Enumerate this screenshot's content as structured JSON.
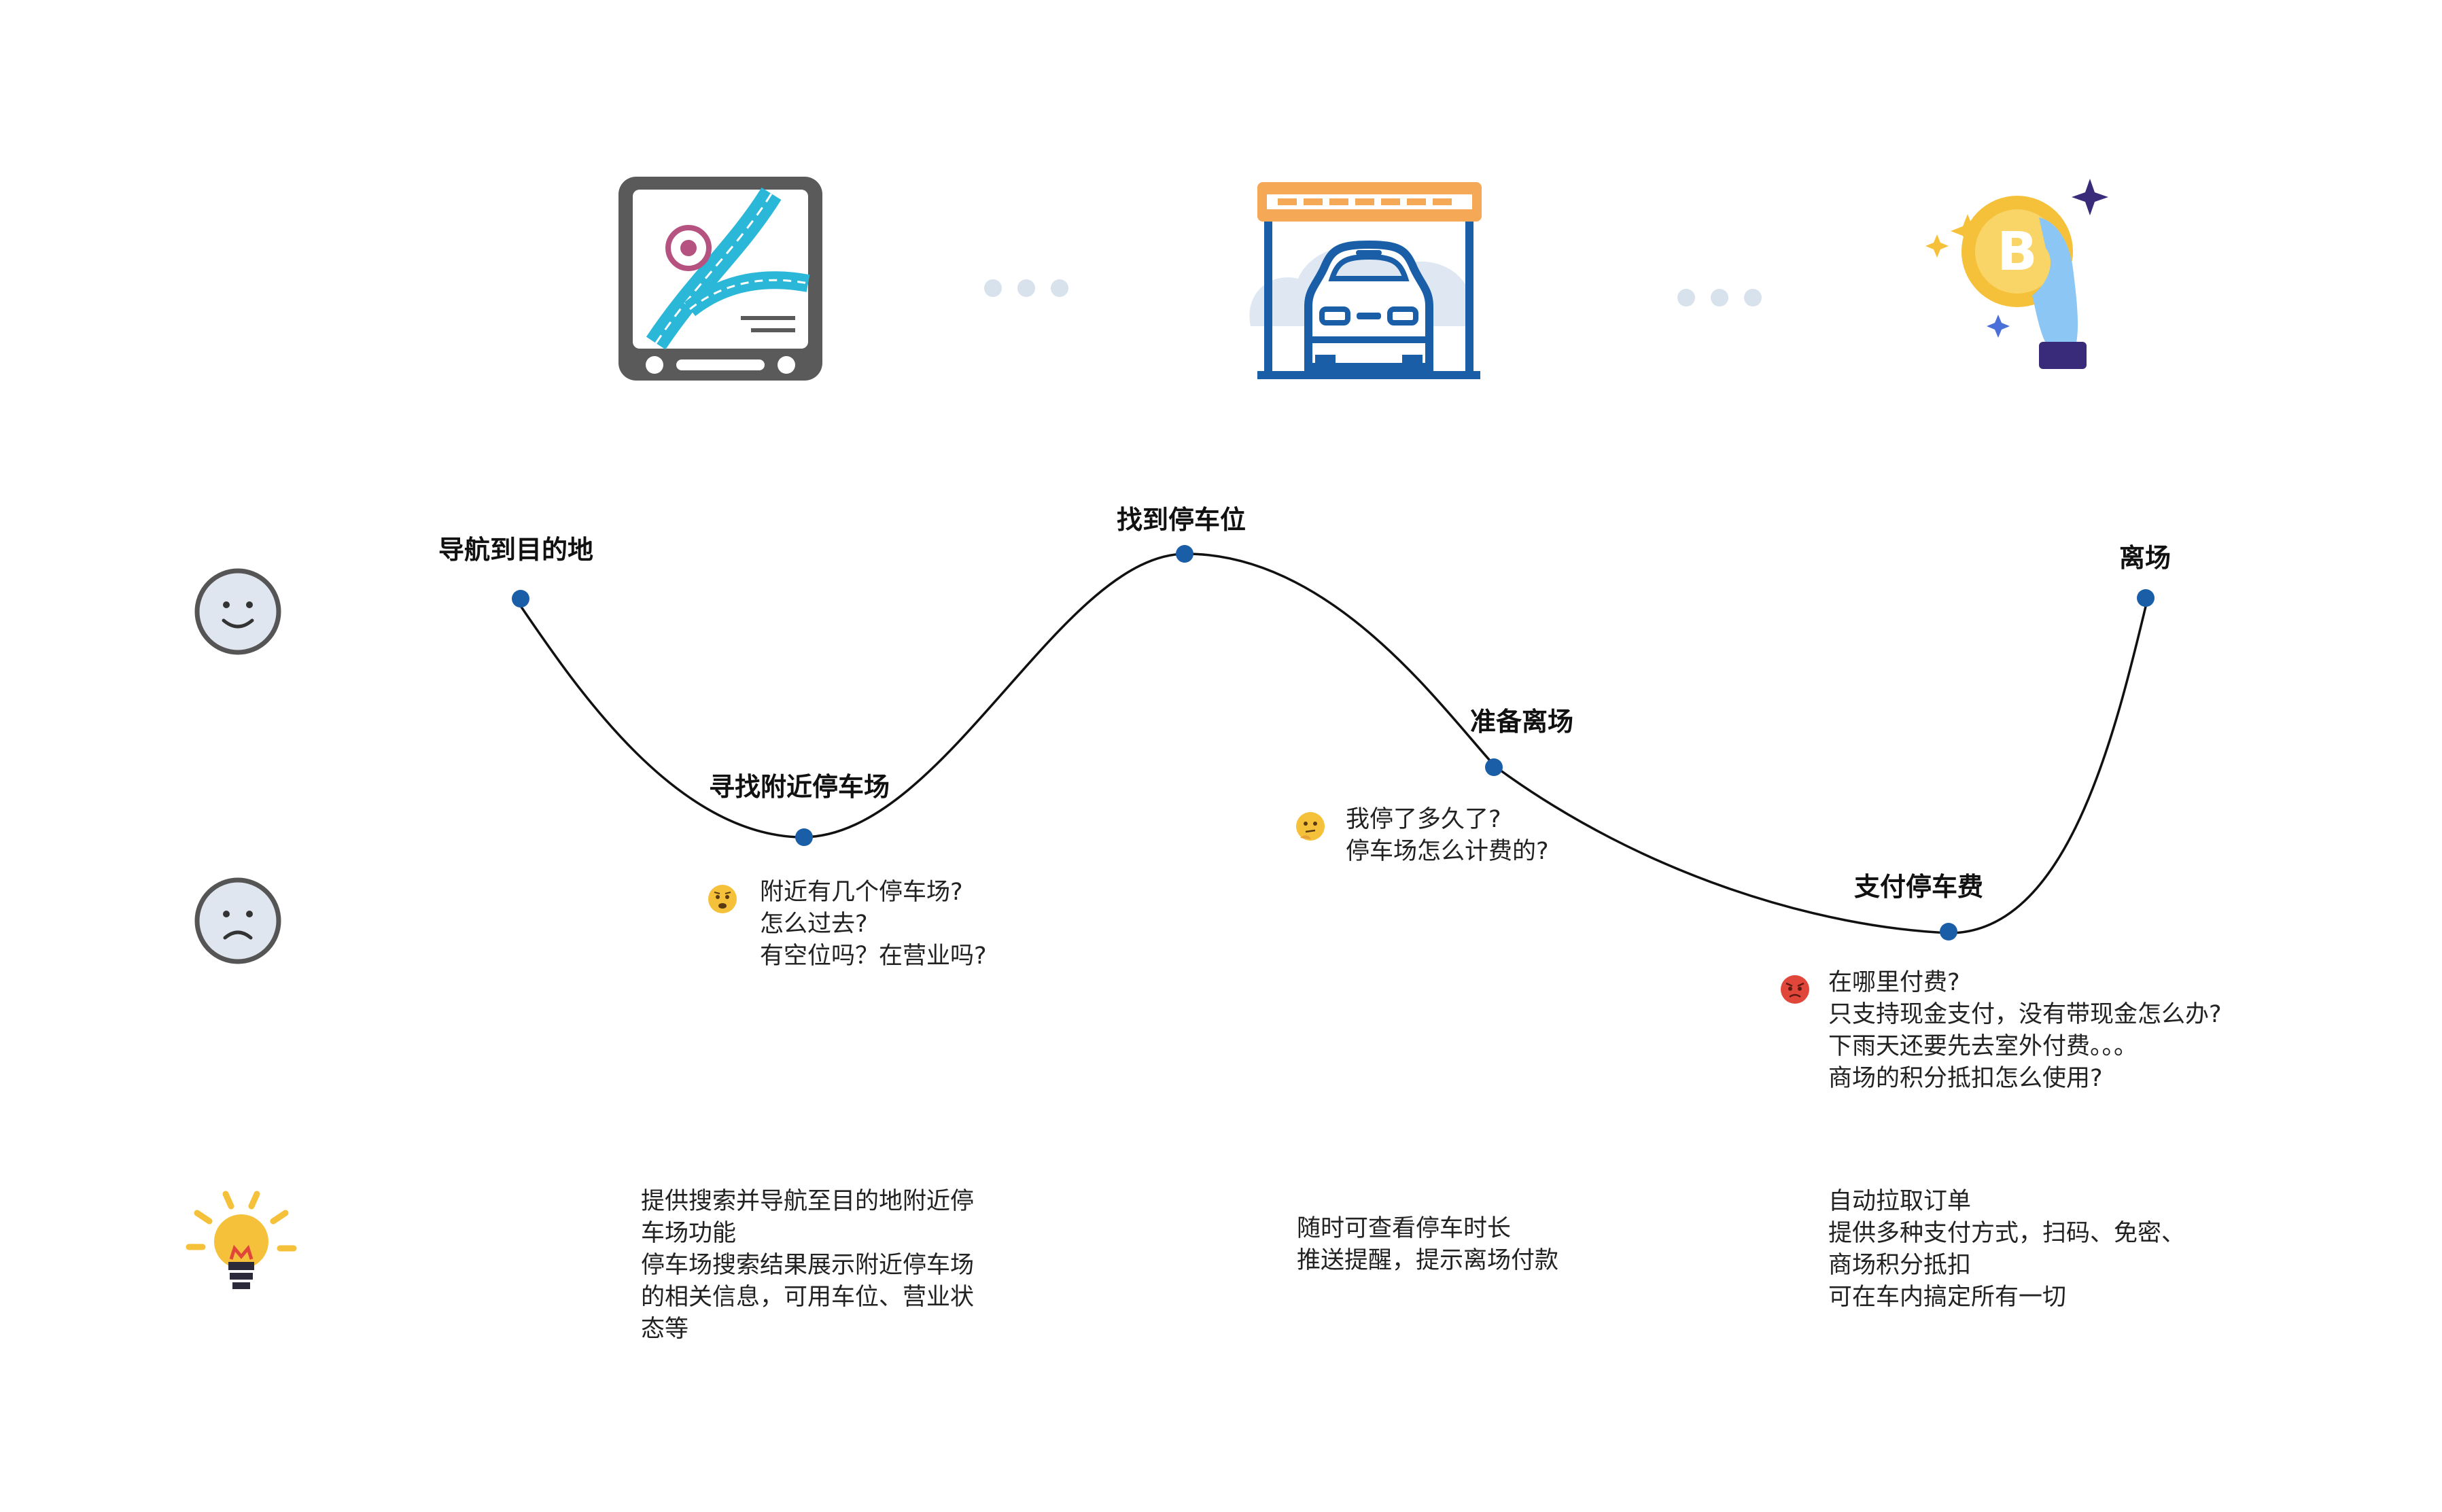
{
  "stages": [
    {
      "label": "导航到目的地"
    },
    {
      "label": "寻找附近停车场"
    },
    {
      "label": "找到停车位"
    },
    {
      "label": "准备离场"
    },
    {
      "label": "支付停车费"
    },
    {
      "label": "离场"
    }
  ],
  "pain_points": [
    {
      "mood": "worried-face-icon",
      "lines": [
        "附近有几个停车场?",
        "怎么过去?",
        "有空位吗？在营业吗?"
      ]
    },
    {
      "mood": "thinking-face-icon",
      "lines": [
        "我停了多久了?",
        "停车场怎么计费的?"
      ]
    },
    {
      "mood": "angry-face-icon",
      "lines": [
        "在哪里付费?",
        "只支持现金支付，没有带现金怎么办?",
        "下雨天还要先去室外付费。。。",
        "商场的积分抵扣怎么使用?"
      ]
    }
  ],
  "ideas": [
    {
      "lines": [
        "提供搜索并导航至目的地附近停",
        "车场功能",
        "停车场搜索结果展示附近停车场",
        "的相关信息，可用车位、营业状",
        "态等"
      ]
    },
    {
      "lines": [
        "随时可查看停车时长",
        "推送提醒，提示离场付款"
      ]
    },
    {
      "lines": [
        "自动拉取订单",
        "提供多种支付方式，扫码、免密、",
        "商场积分抵扣",
        "可在车内搞定所有一切"
      ]
    }
  ],
  "icons": [
    "navigation-map-icon",
    "parking-garage-car-icon",
    "bitcoin-payment-hand-icon"
  ],
  "row_icons": [
    "happy-face-icon",
    "sad-face-icon",
    "lightbulb-icon"
  ],
  "colors": {
    "curve": "#111111",
    "point": "#1a5ea8",
    "face_ring": "#555555",
    "face_fill": "#dfe6ef",
    "dots": "#d8e2ec"
  }
}
